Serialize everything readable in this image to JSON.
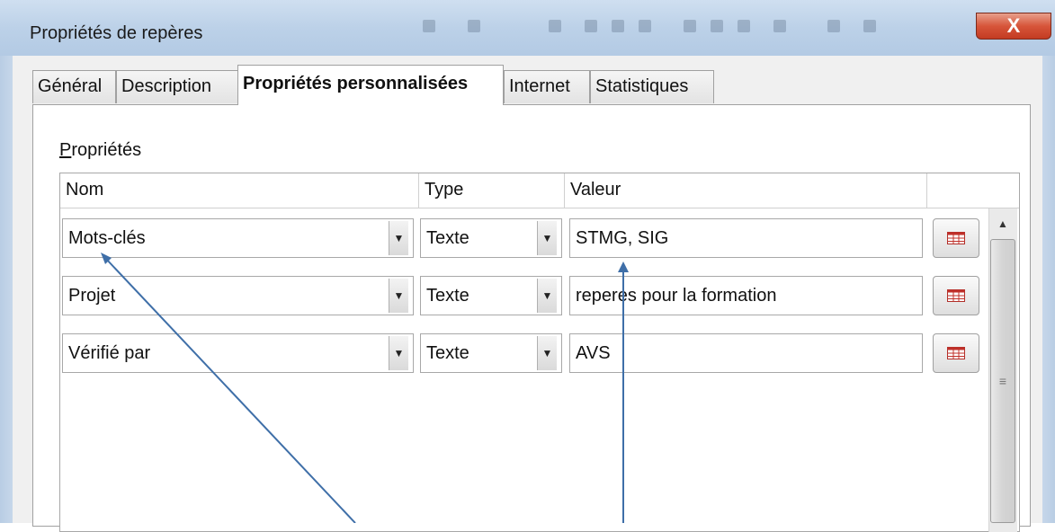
{
  "window": {
    "title": "Propriétés de repères",
    "close_glyph": "X"
  },
  "tabs": [
    {
      "label": "Général",
      "active": false
    },
    {
      "label": "Description",
      "active": false
    },
    {
      "label": "Propriétés personnalisées",
      "active": true
    },
    {
      "label": "Internet",
      "active": false
    },
    {
      "label": "Statistiques",
      "active": false
    }
  ],
  "section": {
    "accel": "P",
    "rest": "ropriétés"
  },
  "columns": {
    "name": "Nom",
    "type": "Type",
    "value": "Valeur"
  },
  "rows": [
    {
      "name": "Mots-clés",
      "type": "Texte",
      "value": "STMG, SIG"
    },
    {
      "name": "Projet",
      "type": "Texte",
      "value": "reperes pour la formation"
    },
    {
      "name": "Vérifié par",
      "type": "Texte",
      "value": "AVS"
    }
  ],
  "colors": {
    "annotation_arrow": "#3f6fa8",
    "delete_icon": "#c0302a"
  },
  "icons": {
    "dropdown": "triangle-down-icon",
    "delete": "delete-property-icon",
    "scroll_up": "triangle-up-icon",
    "scroll_grip": "grip-icon"
  }
}
